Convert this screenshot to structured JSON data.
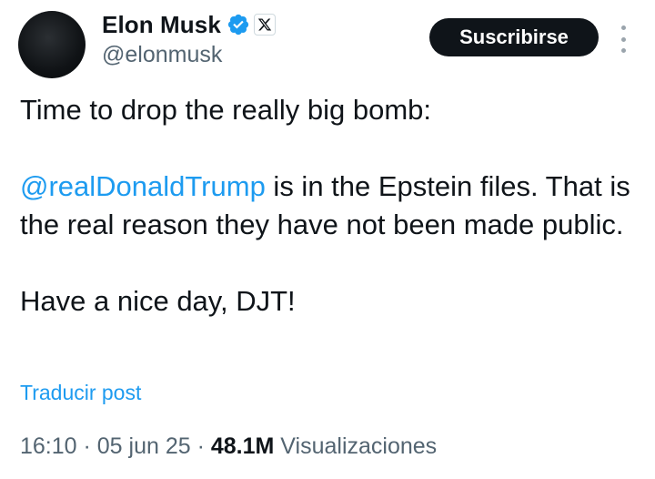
{
  "author": {
    "display_name": "Elon Musk",
    "handle": "@elonmusk",
    "verified_icon": "verified-badge-icon",
    "affiliation_icon": "x-logo-icon"
  },
  "actions": {
    "subscribe_label": "Suscribirse",
    "more_icon": "more-vertical-icon"
  },
  "post": {
    "line1": "Time to drop the really big bomb:",
    "mention": "@realDonaldTrump",
    "line2_rest": " is in the Epstein files. That is the real reason they have not been made public.",
    "line3": "Have a nice day, DJT!"
  },
  "translate_label": "Traducir post",
  "meta": {
    "time": "16:10",
    "sep1": " · ",
    "date": "05 jun 25",
    "sep2": " · ",
    "views_count": "48.1M",
    "views_label": " Visualizaciones"
  },
  "colors": {
    "link": "#1d9bf0",
    "text": "#0f1419",
    "secondary": "#536471",
    "button_bg": "#0f1419"
  }
}
